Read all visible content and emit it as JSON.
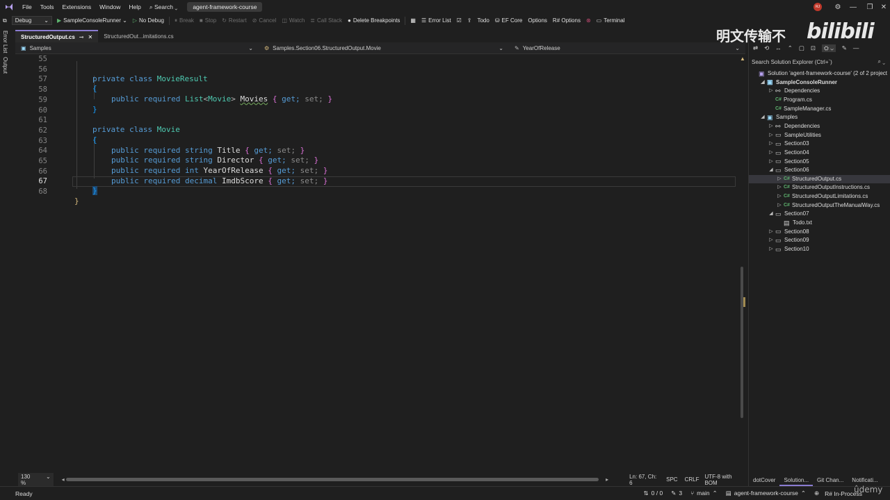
{
  "menubar": {
    "items": [
      "File",
      "Tools",
      "Extensions",
      "Window",
      "Help",
      "Search"
    ],
    "solution_name": "agent-framework-course",
    "avatar_initials": "RJ"
  },
  "toolbar": {
    "config": "Debug",
    "start_project": "SampleConsoleRunner",
    "no_debug": "No Debug",
    "break": "Break",
    "stop": "Stop",
    "restart": "Restart",
    "cancel": "Cancel",
    "watch": "Watch",
    "call_stack": "Call Stack",
    "delete_breakpoints": "Delete Breakpoints",
    "error_list": "Error List",
    "todo": "Todo",
    "ef_core": "EF Core",
    "options": "Options",
    "rs_options": "R# Options",
    "terminal": "Terminal"
  },
  "left_strip": {
    "error_list": "Error List",
    "output": "Output"
  },
  "tabs": [
    {
      "label": "StructuredOutput.cs",
      "active": true
    },
    {
      "label": "StructuredOut...imitations.cs",
      "active": false
    }
  ],
  "navbar": {
    "project": "Samples",
    "type": "Samples.Section06.StructuredOutput.Movie",
    "member": "YearOfRelease"
  },
  "editor": {
    "current_line": "67",
    "lines": [
      {
        "num": "55"
      },
      {
        "num": "56",
        "tokens": [
          "private",
          "class",
          "MovieResult"
        ]
      },
      {
        "num": "57",
        "tokens": [
          "{"
        ]
      },
      {
        "num": "58",
        "tokens": [
          "public",
          "required",
          "List",
          "<",
          "Movie",
          ">",
          "Movies",
          "{",
          "get;",
          "set;",
          "}"
        ]
      },
      {
        "num": "59",
        "tokens": [
          "}"
        ]
      },
      {
        "num": "60"
      },
      {
        "num": "61",
        "tokens": [
          "private",
          "class",
          "Movie"
        ]
      },
      {
        "num": "62",
        "tokens": [
          "{"
        ]
      },
      {
        "num": "63",
        "tokens": [
          "public",
          "required",
          "string",
          "Title",
          "{",
          "get;",
          "set;",
          "}"
        ]
      },
      {
        "num": "64",
        "tokens": [
          "public",
          "required",
          "string",
          "Director",
          "{",
          "get;",
          "set;",
          "}"
        ]
      },
      {
        "num": "65",
        "tokens": [
          "public",
          "required",
          "int",
          "YearOfRelease",
          "{",
          "get;",
          "set;",
          "}"
        ]
      },
      {
        "num": "66",
        "tokens": [
          "public",
          "required",
          "decimal",
          "ImdbScore",
          "{",
          "get;",
          "set;",
          "}"
        ]
      },
      {
        "num": "67",
        "tokens": [
          "}"
        ]
      },
      {
        "num": "68",
        "tokens": [
          "}"
        ]
      }
    ]
  },
  "editor_status": {
    "zoom": "130 %",
    "position": "Ln: 67, Ch: 6",
    "whitespace": "SPC",
    "line_ending": "CRLF",
    "encoding": "UTF-8 with BOM"
  },
  "solution_explorer": {
    "search_placeholder": "Search Solution Explorer (Ctrl+`)",
    "items": [
      {
        "label": "Solution 'agent-framework-course' (2 of 2 project",
        "indent": 0,
        "kind": "solution"
      },
      {
        "label": "SampleConsoleRunner",
        "indent": 1,
        "kind": "project",
        "expanded": true
      },
      {
        "label": "Dependencies",
        "indent": 2,
        "kind": "deps"
      },
      {
        "label": "Program.cs",
        "indent": 2,
        "kind": "cs"
      },
      {
        "label": "SampleManager.cs",
        "indent": 2,
        "kind": "cs"
      },
      {
        "label": "Samples",
        "indent": 1,
        "kind": "project",
        "expanded": true
      },
      {
        "label": "Dependencies",
        "indent": 2,
        "kind": "deps"
      },
      {
        "label": "SampleUtilities",
        "indent": 2,
        "kind": "folder"
      },
      {
        "label": "Section03",
        "indent": 2,
        "kind": "folder"
      },
      {
        "label": "Section04",
        "indent": 2,
        "kind": "folder"
      },
      {
        "label": "Section05",
        "indent": 2,
        "kind": "folder"
      },
      {
        "label": "Section06",
        "indent": 2,
        "kind": "folder",
        "expanded": true
      },
      {
        "label": "StructuredOutput.cs",
        "indent": 3,
        "kind": "cs",
        "selected": true
      },
      {
        "label": "StructuredOutputInstructions.cs",
        "indent": 3,
        "kind": "cs"
      },
      {
        "label": "StructuredOutputLimitations.cs",
        "indent": 3,
        "kind": "cs"
      },
      {
        "label": "StructuredOutputTheManualWay.cs",
        "indent": 3,
        "kind": "cs"
      },
      {
        "label": "Section07",
        "indent": 2,
        "kind": "folder",
        "expanded": true
      },
      {
        "label": "Todo.txt",
        "indent": 3,
        "kind": "txt"
      },
      {
        "label": "Section08",
        "indent": 2,
        "kind": "folder"
      },
      {
        "label": "Section09",
        "indent": 2,
        "kind": "folder"
      },
      {
        "label": "Section10",
        "indent": 2,
        "kind": "folder"
      }
    ],
    "bottom_tabs": [
      "dotCover",
      "Solution...",
      "Git Chan...",
      "Notificati..."
    ]
  },
  "statusbar": {
    "ready": "Ready",
    "git_changes": "0 / 0",
    "edits": "3",
    "branch": "main",
    "repo": "agent-framework-course",
    "resharper": "R# In-Process"
  },
  "watermark": {
    "text_cn": "明文传输不",
    "brand": "bilibili",
    "udemy": "ûdemy"
  },
  "colors": {
    "keyword": "#569cd6",
    "type": "#4ec9b0",
    "accent": "#8a7cd1"
  }
}
